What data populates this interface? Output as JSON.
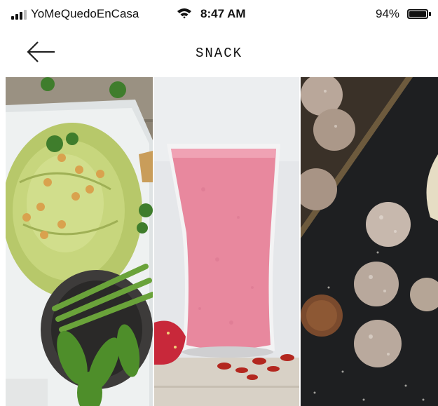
{
  "status_bar": {
    "carrier": "YoMeQuedoEnCasa",
    "time": "8:47 AM",
    "battery_percent": "94%",
    "battery_level": 0.94,
    "icons": [
      "signal-icon",
      "wifi-icon",
      "battery-icon"
    ]
  },
  "header": {
    "title": "SNACK",
    "back_icon": "arrow-left-icon"
  },
  "gallery": {
    "panels": [
      {
        "name": "hummus-platter-image",
        "description_icon": "image"
      },
      {
        "name": "berry-smoothie-image",
        "description_icon": "image"
      },
      {
        "name": "energy-balls-image",
        "description_icon": "image"
      }
    ]
  },
  "colors": {
    "background": "#ffffff",
    "text": "#111111"
  }
}
